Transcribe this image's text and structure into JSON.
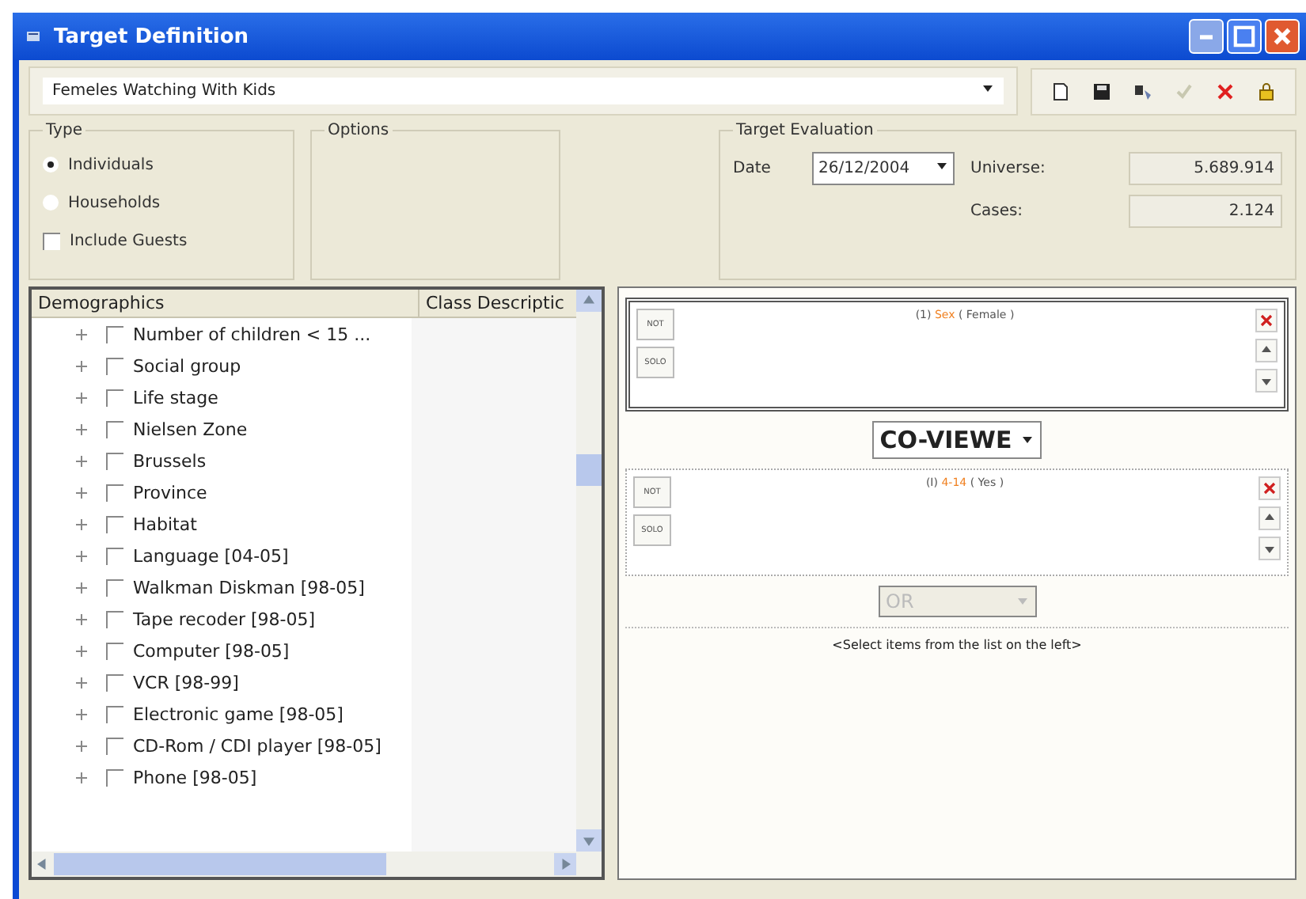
{
  "window": {
    "title": "Target Definition"
  },
  "target_name": {
    "value": "Femeles Watching With Kids"
  },
  "type_group": {
    "title": "Type",
    "options": [
      {
        "label": "Individuals",
        "selected": true
      },
      {
        "label": "Households",
        "selected": false
      }
    ],
    "include_guests": {
      "label": "Include Guests",
      "checked": false
    }
  },
  "options_group": {
    "title": "Options"
  },
  "evaluation": {
    "title": "Target Evaluation",
    "date_label": "Date",
    "date": "26/12/2004",
    "universe_label": "Universe:",
    "universe": "5.689.914",
    "cases_label": "Cases:",
    "cases": "2.124"
  },
  "tree": {
    "columns": [
      "Demographics",
      "Class Descriptic"
    ],
    "items": [
      {
        "label": "Number of children < 15 ...",
        "checked": false
      },
      {
        "label": "Social group",
        "checked": false
      },
      {
        "label": "Life stage",
        "checked": false
      },
      {
        "label": "Nielsen Zone",
        "checked": false
      },
      {
        "label": "Brussels",
        "checked": false
      },
      {
        "label": "Province",
        "checked": false
      },
      {
        "label": "Habitat",
        "checked": false
      },
      {
        "label": "Language [04-05]",
        "checked": false
      },
      {
        "label": "Walkman Diskman [98-05]",
        "checked": false
      },
      {
        "label": "Tape recoder [98-05]",
        "checked": false
      },
      {
        "label": "Computer [98-05]",
        "checked": false
      },
      {
        "label": "VCR [98-99]",
        "checked": false
      },
      {
        "label": "Electronic game [98-05]",
        "checked": false
      },
      {
        "label": "CD-Rom / CDI player [98-05]",
        "checked": false
      },
      {
        "label": "Phone [98-05]",
        "checked": false
      }
    ]
  },
  "conditions": [
    {
      "prefix": "(1)",
      "variable": "Sex",
      "value": "( Female )",
      "not": "NOT",
      "solo": "SOLO",
      "selected": true
    },
    {
      "prefix": "(I)",
      "variable": "4-14",
      "value": "( Yes )",
      "not": "NOT",
      "solo": "SOLO",
      "selected": false
    }
  ],
  "operators": [
    {
      "label": "CO-VIEWE",
      "disabled": false
    },
    {
      "label": "OR",
      "disabled": true
    }
  ],
  "empty_hint": "<Select items from the list on the left>"
}
